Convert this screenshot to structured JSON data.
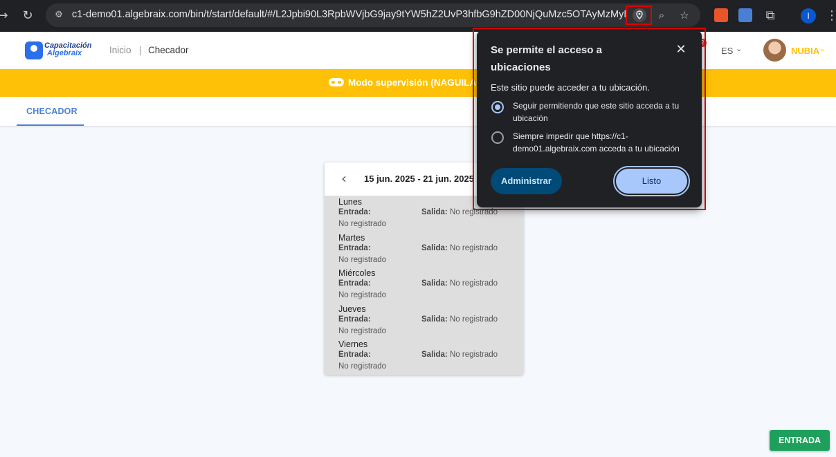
{
  "browser": {
    "url": "c1-demo01.algebraix.com/bin/t/start/default/#/L2Jpbi90L3RpbWVjbG9jay9tYW5hZ2UvP3hfbG9hZD00NjQuMzc5OTAyMzMyMyN...",
    "profile_initial": "I",
    "icons": [
      "back-icon",
      "reload-icon",
      "site-info-icon",
      "location-icon",
      "zoom-icon",
      "bookmark-star-icon",
      "extension-icon",
      "menu-dots-icon"
    ]
  },
  "header": {
    "logo_line1": "Capacitación",
    "logo_line2": "Algebraix",
    "breadcrumb_home": "Inicio",
    "breadcrumb_sep": "|",
    "breadcrumb_current": "Checador",
    "notif_count": "2",
    "language": "ES",
    "user_name": "NUBIA"
  },
  "banner": {
    "text": "Modo supervisión (NAGUILAR)"
  },
  "tabs": [
    {
      "label": "CHECADOR",
      "active": true
    }
  ],
  "week": {
    "range": "15 jun. 2025 - 21 jun. 2025",
    "entry_label": "Entrada:",
    "exit_label": "Salida:",
    "days": [
      {
        "name": "Lunes",
        "entrada": "No registrado",
        "salida": "No registrado"
      },
      {
        "name": "Martes",
        "entrada": "No registrado",
        "salida": "No registrado"
      },
      {
        "name": "Miércoles",
        "entrada": "No registrado",
        "salida": "No registrado"
      },
      {
        "name": "Jueves",
        "entrada": "No registrado",
        "salida": "No registrado"
      },
      {
        "name": "Viernes",
        "entrada": "No registrado",
        "salida": "No registrado"
      }
    ]
  },
  "popup": {
    "title": "Se permite el acceso a ubicaciones",
    "subtitle": "Este sitio puede acceder a tu ubicación.",
    "options": [
      {
        "label": "Seguir permitiendo que este sitio acceda a tu ubicación",
        "selected": true
      },
      {
        "label": "Siempre impedir que https://c1-demo01.algebraix.com acceda a tu ubicación",
        "selected": false
      }
    ],
    "manage_label": "Administrar",
    "done_label": "Listo"
  },
  "actions": {
    "entrada_label": "ENTRADA"
  },
  "colors": {
    "accent_yellow": "#ffc107",
    "tab_blue": "#4a7fd6",
    "entrada_green": "#1ea05c",
    "highlight_red": "#e00000"
  }
}
